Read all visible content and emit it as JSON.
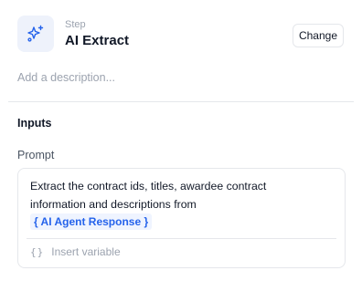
{
  "step": {
    "kicker": "Step",
    "title": "AI Extract",
    "icon": "sparkles-icon",
    "change_label": "Change"
  },
  "description": {
    "placeholder": "Add a description..."
  },
  "inputs": {
    "section_title": "Inputs",
    "prompt": {
      "label": "Prompt",
      "text_line1": "Extract the contract ids, titles, awardee contract",
      "text_line2": "information and descriptions from",
      "variable": "{ AI Agent Response }",
      "insert_label": "Insert variable",
      "insert_icon": "braces-icon"
    }
  },
  "colors": {
    "accent": "#2563eb",
    "icon_bg": "#eef2fb",
    "muted": "#9ca3af",
    "border": "#e5e7eb"
  }
}
